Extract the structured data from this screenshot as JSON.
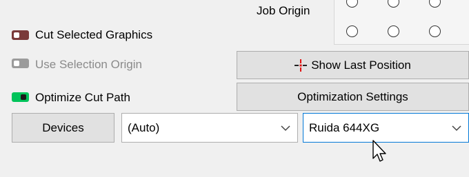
{
  "job_origin": {
    "label": "Job Origin",
    "rows": 2,
    "cols": 3
  },
  "options": {
    "cut_selected": {
      "label": "Cut Selected Graphics",
      "state": "on",
      "color": "#7a3a3a"
    },
    "use_selection_origin": {
      "label": "Use Selection Origin",
      "state": "disabled",
      "color": "#9b9b9b"
    },
    "optimize_cut_path": {
      "label": "Optimize Cut Path",
      "state": "on",
      "color": "#00c35a"
    }
  },
  "buttons": {
    "show_last_position": "Show Last Position",
    "optimization_settings": "Optimization Settings",
    "devices": "Devices"
  },
  "selects": {
    "port": {
      "value": "(Auto)"
    },
    "device": {
      "value": "Ruida 644XG"
    }
  },
  "icons": {
    "crosshair": "crosshair-icon",
    "chevron": "chevron-down-icon",
    "cursor": "mouse-cursor-icon"
  },
  "colors": {
    "crosshair_red": "#e01010",
    "focus_blue": "#0078d7"
  }
}
